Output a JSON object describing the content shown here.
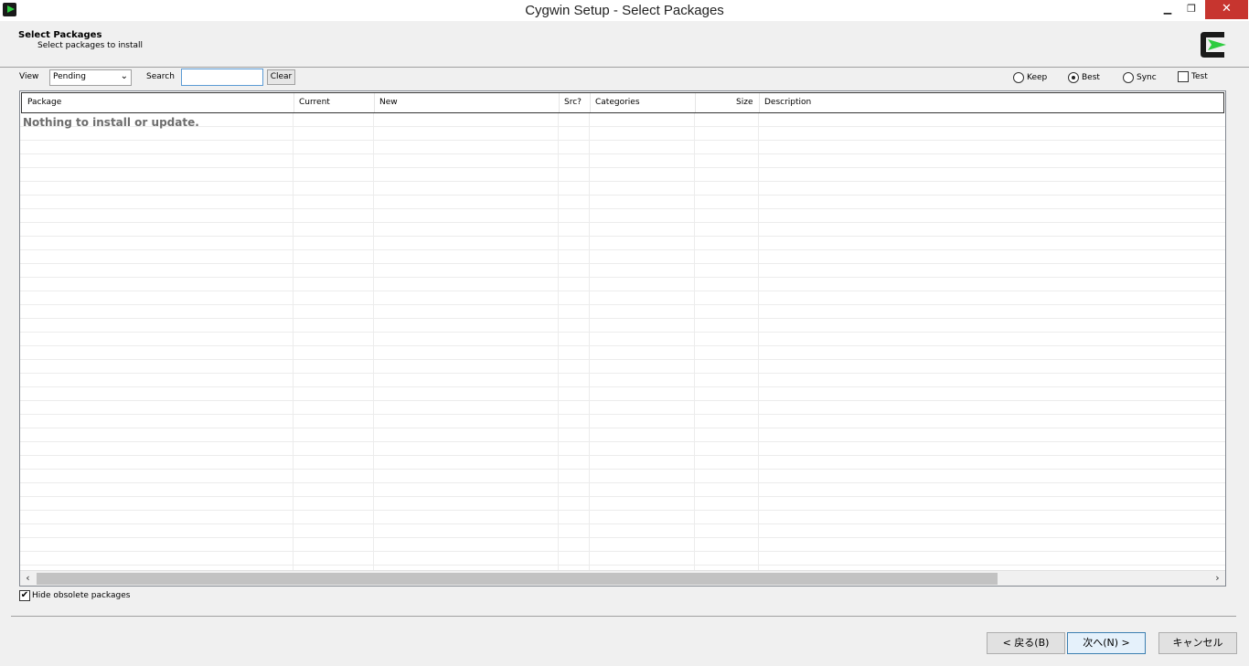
{
  "window": {
    "title": "Cygwin Setup - Select Packages",
    "min_glyph": "▁",
    "max_glyph": "❐",
    "close_glyph": "✕"
  },
  "header": {
    "title": "Select Packages",
    "subtitle": "Select packages to install"
  },
  "toolbar": {
    "view_label": "View",
    "view_value": "Pending",
    "search_label": "Search",
    "search_value": "",
    "clear_label": "Clear",
    "options": {
      "keep": "Keep",
      "best": "Best",
      "sync": "Sync",
      "test": "Test",
      "selected": "Best",
      "test_checked": false
    }
  },
  "table": {
    "columns": [
      "Package",
      "Current",
      "New",
      "Src?",
      "Categories",
      "Size",
      "Description"
    ],
    "empty_message": "Nothing to install or update.",
    "horizontal_scroll_fraction": 0.82
  },
  "hide_obsolete": {
    "label": "Hide obsolete packages",
    "checked": true
  },
  "buttons": {
    "back": "< 戻る(B)",
    "next": "次へ(N) >",
    "cancel": "キャンセル"
  },
  "colors": {
    "accent_green": "#2ecc40",
    "close_red": "#c7352f"
  }
}
